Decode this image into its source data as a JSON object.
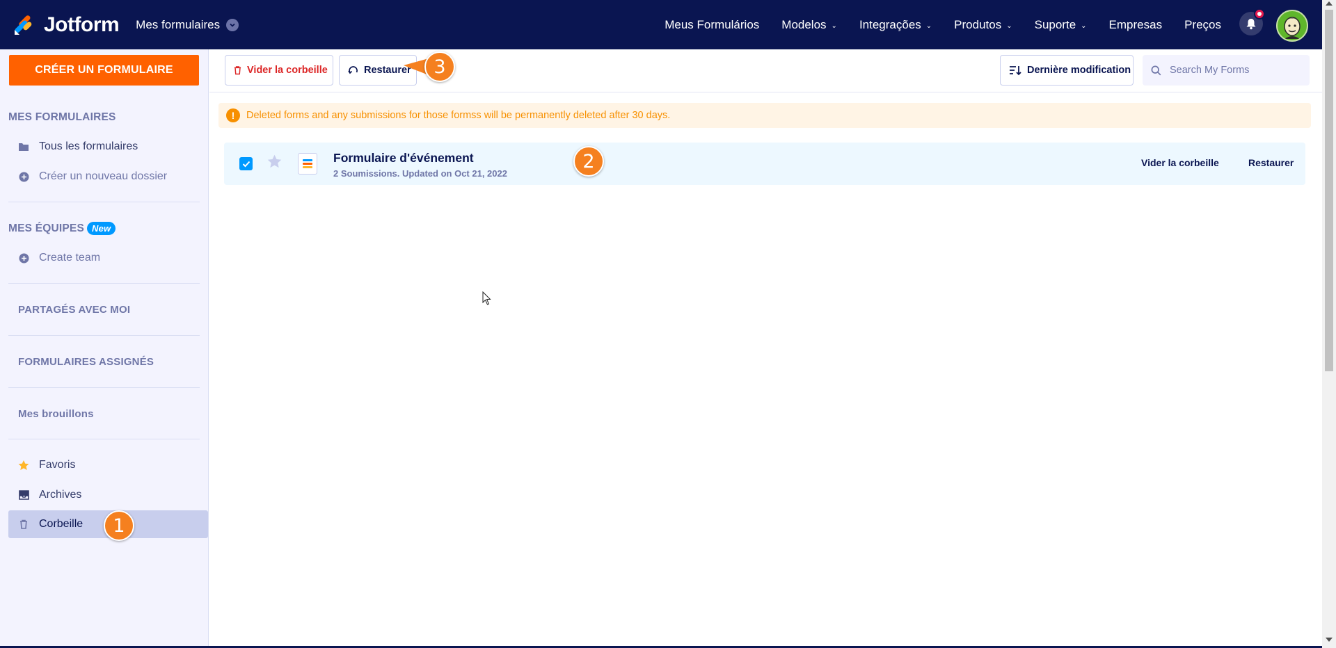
{
  "header": {
    "brand": "Jotform",
    "workspace": "Mes formulaires",
    "nav": [
      {
        "label": "Meus Formulários",
        "caret": false
      },
      {
        "label": "Modelos",
        "caret": true
      },
      {
        "label": "Integrações",
        "caret": true
      },
      {
        "label": "Produtos",
        "caret": true
      },
      {
        "label": "Suporte",
        "caret": true
      },
      {
        "label": "Empresas",
        "caret": false
      },
      {
        "label": "Preços",
        "caret": false
      }
    ]
  },
  "sidebar": {
    "create_label": "CRÉER UN FORMULAIRE",
    "my_forms_heading": "MES FORMULAIRES",
    "all_forms": "Tous les formulaires",
    "new_folder": "Créer un nouveau dossier",
    "teams_heading": "MES ÉQUIPES",
    "new_badge": "New",
    "create_team": "Create team",
    "shared": "PARTAGÉS AVEC MOI",
    "assigned": "FORMULAIRES ASSIGNÉS",
    "drafts": "Mes brouillons",
    "favorites": "Favoris",
    "archives": "Archives",
    "trash": "Corbeille"
  },
  "toolbar": {
    "empty_trash": "Vider la corbeille",
    "restore": "Restaurer",
    "sort": "Dernière modification",
    "search_placeholder": "Search My Forms"
  },
  "banner": {
    "text": "Deleted forms and any submissions for those formss will be permanently deleted after 30 days."
  },
  "form": {
    "title": "Formulaire d'événement",
    "meta": "2 Soumissions. Updated on Oct 21, 2022",
    "empty_trash": "Vider la corbeille",
    "restore": "Restaurer"
  },
  "markers": [
    "1",
    "2",
    "3"
  ],
  "colors": {
    "nav_bg": "#0a1551",
    "accent": "#ff6100",
    "sidebar_bg": "#f3f3fe",
    "active_item": "#c8ceed",
    "danger": "#dc2626",
    "warning": "#f79000",
    "row_bg": "#edf8ff",
    "marker": "#f5801f"
  }
}
